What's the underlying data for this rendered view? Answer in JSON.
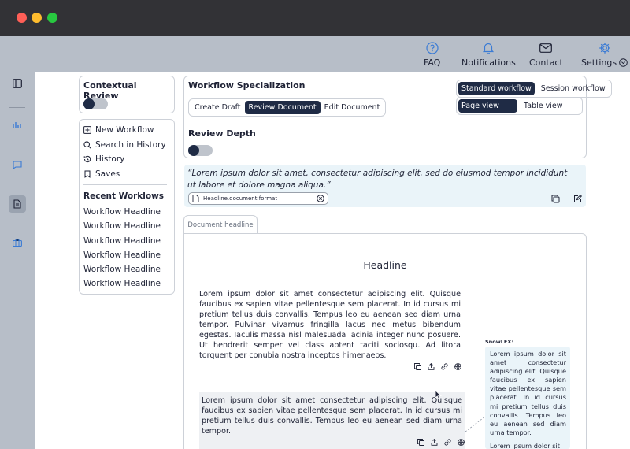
{
  "topnav": {
    "items": [
      {
        "label": "FAQ",
        "icon": "help-circle-icon"
      },
      {
        "label": "Notifications",
        "icon": "bell-icon"
      },
      {
        "label": "Contact",
        "icon": "mail-icon"
      },
      {
        "label": "Settings",
        "icon": "gear-icon"
      }
    ]
  },
  "contextual": {
    "title": "Contextual Review"
  },
  "menu": {
    "items": [
      {
        "label": "New Workflow",
        "icon": "plus-square-icon"
      },
      {
        "label": "Search in History",
        "icon": "search-icon"
      },
      {
        "label": "History",
        "icon": "history-icon"
      },
      {
        "label": "Saves",
        "icon": "bookmark-icon"
      }
    ],
    "recent_title": "Recent Worklows",
    "recent": [
      "Workflow Headline",
      "Workflow Headline",
      "Workflow Headline",
      "Workflow Headline",
      "Workflow Headline",
      "Workflow Headline"
    ]
  },
  "workflow": {
    "title": "Workflow Specialization",
    "steps": [
      "Create Draft",
      "Review Document",
      "Edit Document"
    ],
    "active_step": "Review Document",
    "modes": [
      "Standard workflow",
      "Session workflow"
    ],
    "active_mode": "Standard workflow",
    "views": [
      "Page view",
      "Table view"
    ],
    "active_view": "Page view",
    "depth_title": "Review Depth"
  },
  "quote": {
    "text": "“Lorem ipsum dolor sit amet, consectetur adipiscing elit, sed do eiusmod tempor incididunt ut labore et dolore magna aliqua.”",
    "file": "Headline.document format"
  },
  "document": {
    "tab": "Document headline",
    "headline": "Headline",
    "para1": "Lorem ipsum dolor sit amet consectetur adipiscing elit. Quisque faucibus ex sapien vitae pellentesque sem placerat. In id cursus mi pretium tellus duis convallis. Tempus leo eu aenean sed diam urna tempor. Pulvinar vivamus fringilla lacus nec metus bibendum egestas. Iaculis massa nisl malesuada lacinia integer nunc posuere. Ut hendrerit semper vel class aptent taciti sociosqu. Ad litora torquent per conubia nostra inceptos himenaeos.",
    "para2": "Lorem ipsum dolor sit amet consectetur adipiscing elit. Quisque faucibus ex sapien vitae pellentesque sem placerat. In id cursus mi pretium tellus duis convallis. Tempus leo eu aenean sed diam urna tempor."
  },
  "sidepanel": {
    "label": "SnowLEX:",
    "text": "Lorem ipsum dolor sit amet consectetur adipiscing elit. Quisque faucibus ex sapien vitae pellentesque sem placerat. In id cursus mi pretium tellus duis convallis. Tempus leo eu aenean sed diam urna tempor.",
    "text2": "Lorem ipsum dolor sit"
  },
  "colors": {
    "accent": "#1f2b45",
    "nav_icon": "#3a7bd5",
    "quote_bg": "#eaf4f9",
    "frame": "#b7bec8"
  }
}
